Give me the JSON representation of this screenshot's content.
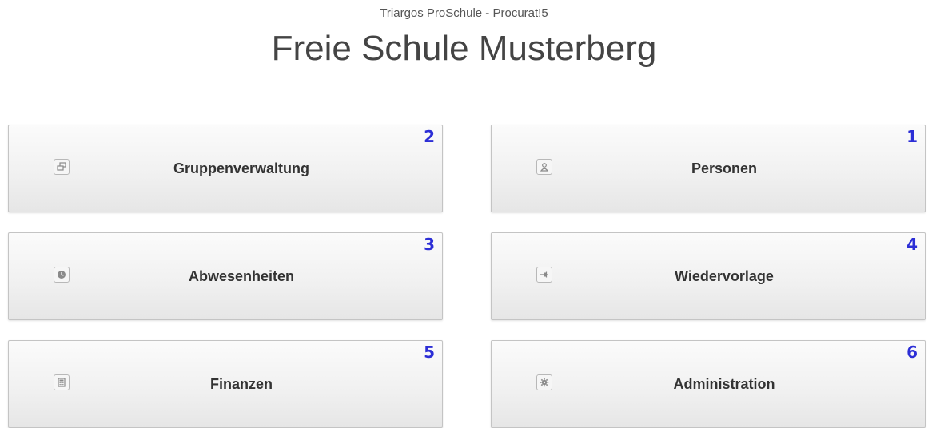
{
  "header": {
    "subtitle": "Triargos ProSchule - Procurat!5",
    "title": "Freie Schule Musterberg"
  },
  "tiles": [
    {
      "label": "Gruppenverwaltung",
      "number": "2",
      "icon": "group-icon"
    },
    {
      "label": "Personen",
      "number": "1",
      "icon": "person-icon"
    },
    {
      "label": "Abwesenheiten",
      "number": "3",
      "icon": "clock-icon"
    },
    {
      "label": "Wiedervorlage",
      "number": "4",
      "icon": "pin-icon"
    },
    {
      "label": "Finanzen",
      "number": "5",
      "icon": "calculator-icon"
    },
    {
      "label": "Administration",
      "number": "6",
      "icon": "gear-icon"
    }
  ],
  "colors": {
    "number": "#2c2ed6",
    "tile_border": "#c4c4c4",
    "title_text": "#444444"
  }
}
